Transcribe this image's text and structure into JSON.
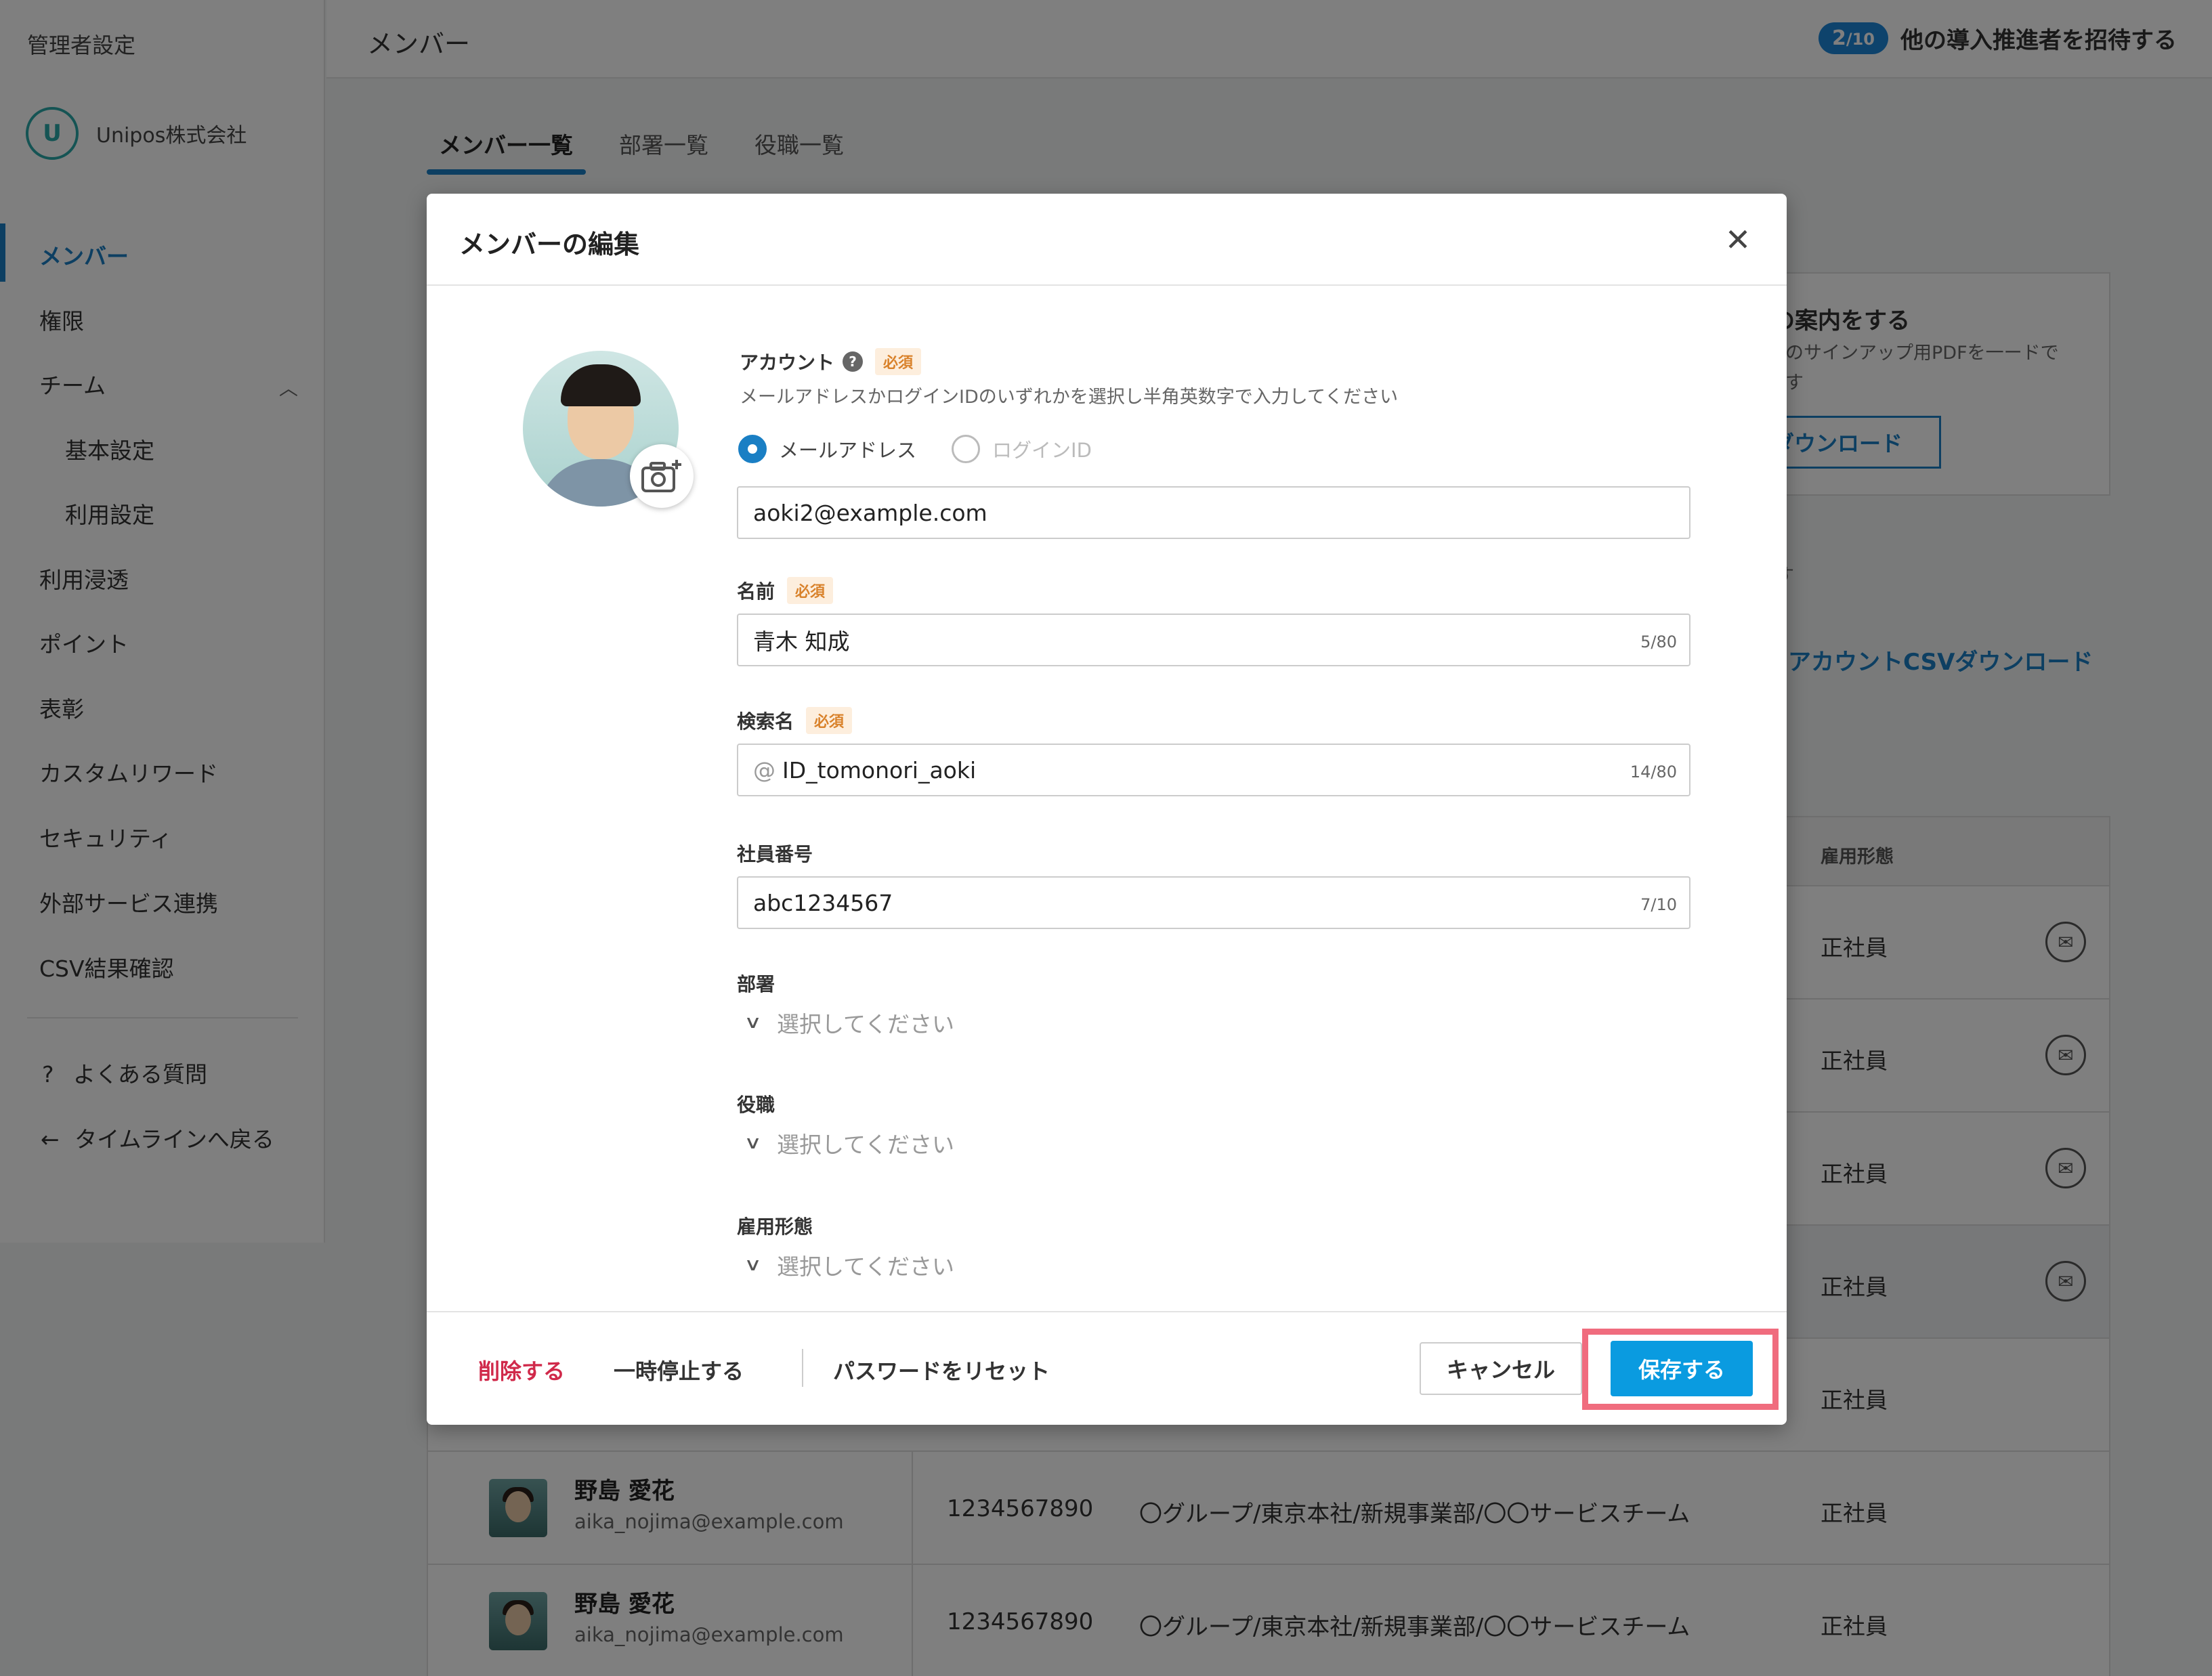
{
  "sidebar": {
    "title": "管理者設定",
    "org_name": "Unipos株式会社",
    "items": [
      {
        "label": "メンバー"
      },
      {
        "label": "権限"
      },
      {
        "label": "チーム"
      },
      {
        "label": "基本設定"
      },
      {
        "label": "利用設定"
      },
      {
        "label": "利用浸透"
      },
      {
        "label": "ポイント"
      },
      {
        "label": "表彰"
      },
      {
        "label": "カスタムリワード"
      },
      {
        "label": "セキュリティ"
      },
      {
        "label": "外部サービス連携"
      },
      {
        "label": "CSV結果確認"
      }
    ],
    "faq": "よくある質問",
    "back": "タイムラインへ戻る"
  },
  "header": {
    "title": "メンバー",
    "invite_count": "2",
    "invite_total": "/10",
    "invite_text": "他の導入推進者を招待する"
  },
  "tabs": [
    {
      "label": "メンバー一覧"
    },
    {
      "label": "部署一覧"
    },
    {
      "label": "役職一覧"
    }
  ],
  "background": {
    "info_title": "プの案内をする",
    "info_desc": "バーのサインアップ用PDFを一ードできます",
    "info_button": "ダウンロード",
    "small_text": "す",
    "csv_link": "アカウントCSVダウンロード",
    "column_employment": "雇用形態",
    "employment_values": [
      "正社員",
      "正社員",
      "正社員",
      "正社員",
      "正社員",
      "正社員",
      "正社員"
    ],
    "rows": [
      {
        "name": "野島 愛花",
        "email": "aika_nojima@example.com",
        "id": "1234567890",
        "dept": "〇グループ/東京本社/新規事業部/〇〇サービスチーム",
        "employment": "正社員"
      },
      {
        "name": "野島 愛花",
        "email": "aika_nojima@example.com",
        "id": "1234567890",
        "dept": "〇グループ/東京本社/新規事業部/〇〇サービスチーム",
        "employment": "正社員"
      }
    ]
  },
  "modal": {
    "title": "メンバーの編集",
    "account_label": "アカウント",
    "required": "必須",
    "account_hint": "メールアドレスかログインIDのいずれかを選択し半角英数字で入力してください",
    "radio_email": "メールアドレス",
    "radio_login": "ログインID",
    "account_value": "aoki2@example.com",
    "name_label": "名前",
    "name_value": "青木 知成",
    "name_counter": "5/80",
    "search_label": "検索名",
    "search_prefix": "@",
    "search_value": "ID_tomonori_aoki",
    "search_counter": "14/80",
    "empno_label": "社員番号",
    "empno_value": "abc1234567",
    "empno_counter": "7/10",
    "dept_label": "部署",
    "role_label": "役職",
    "employment_label": "雇用形態",
    "select_placeholder": "選択してください",
    "delete": "削除する",
    "suspend": "一時停止する",
    "reset_password": "パスワードをリセット",
    "cancel": "キャンセル",
    "save": "保存する"
  }
}
